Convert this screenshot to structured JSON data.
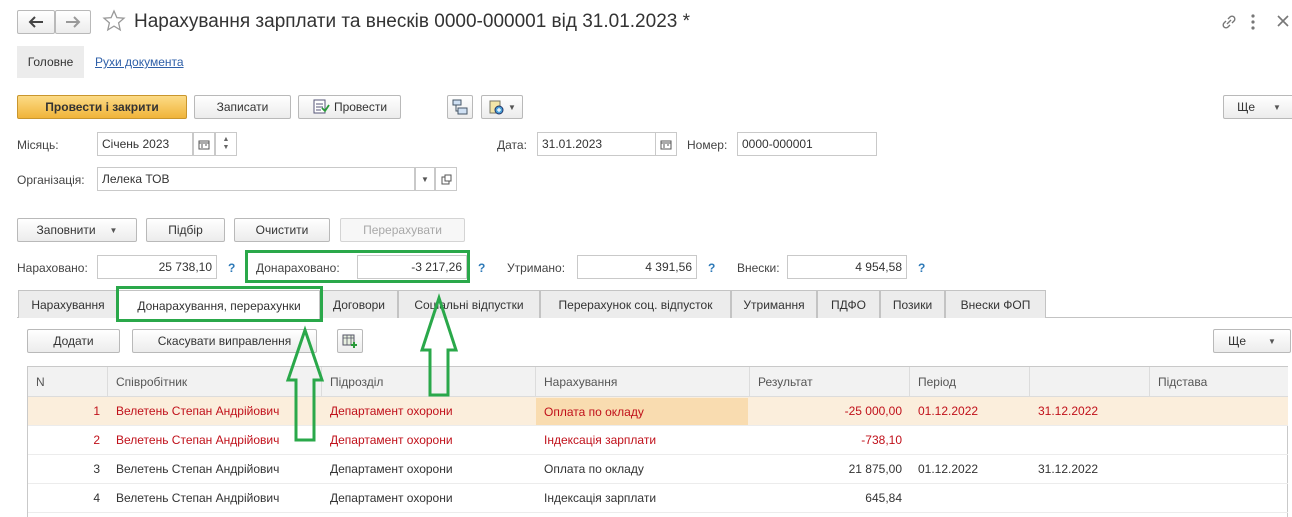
{
  "window": {
    "title": "Нарахування зарплати та внесків 0000-000001 від 31.01.2023 *",
    "nav_tabs": [
      "Головне",
      "Рухи документа"
    ]
  },
  "toolbar": {
    "post_close": "Провести і закрити",
    "save": "Записати",
    "post": "Провести",
    "more": "Ще"
  },
  "form": {
    "month_label": "Місяць:",
    "month_value": "Січень 2023",
    "date_label": "Дата:",
    "date_value": "31.01.2023",
    "number_label": "Номер:",
    "number_value": "0000-000001",
    "org_label": "Організація:",
    "org_value": "Лелека ТОВ"
  },
  "actions": {
    "fill": "Заповнити",
    "select": "Підбір",
    "clear": "Очистити",
    "recalc": "Перерахувати"
  },
  "totals": {
    "accrued_label": "Нараховано:",
    "accrued_value": "25 738,10",
    "extra_label": "Донараховано:",
    "extra_value": "-3 217,26",
    "withheld_label": "Утримано:",
    "withheld_value": "4 391,56",
    "contrib_label": "Внески:",
    "contrib_value": "4 954,58",
    "help": "?"
  },
  "tabs": [
    "Нарахування",
    "Донарахування, перерахунки",
    "Договори",
    "Соціальні відпустки",
    "Перерахунок соц. відпусток",
    "Утримання",
    "ПДФО",
    "Позики",
    "Внески ФОП"
  ],
  "table_toolbar": {
    "add": "Додати",
    "cancel_fix": "Скасувати виправлення",
    "more": "Ще"
  },
  "table": {
    "columns": [
      "N",
      "Співробітник",
      "Підрозділ",
      "Нарахування",
      "Результат",
      "Період",
      "",
      "Підстава"
    ],
    "rows": [
      {
        "n": "1",
        "employee": "Велетень Степан Андрійович",
        "dept": "Департамент охорони",
        "accrual": "Оплата по окладу",
        "result": "-25 000,00",
        "from": "01.12.2022",
        "to": "31.12.2022",
        "basis": ""
      },
      {
        "n": "2",
        "employee": "Велетень Степан Андрійович",
        "dept": "Департамент охорони",
        "accrual": "Індексація зарплати",
        "result": "-738,10",
        "from": "",
        "to": "",
        "basis": ""
      },
      {
        "n": "3",
        "employee": "Велетень Степан Андрійович",
        "dept": "Департамент охорони",
        "accrual": "Оплата по окладу",
        "result": "21 875,00",
        "from": "01.12.2022",
        "to": "31.12.2022",
        "basis": ""
      },
      {
        "n": "4",
        "employee": "Велетень Степан Андрійович",
        "dept": "Департамент охорони",
        "accrual": "Індексація зарплати",
        "result": "645,84",
        "from": "",
        "to": "",
        "basis": ""
      }
    ]
  },
  "colors": {
    "annotation": "#2aa84a",
    "negative": "#c0101a",
    "primary_button": "#f0b43a"
  }
}
